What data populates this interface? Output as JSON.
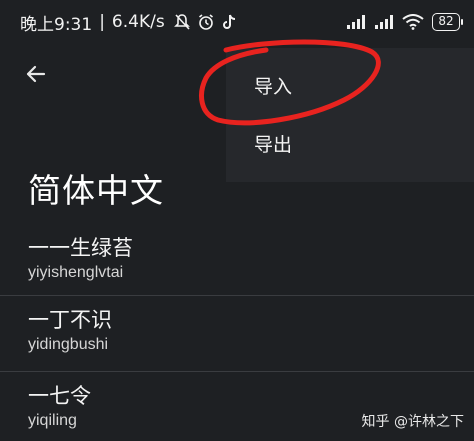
{
  "status_bar": {
    "time": "晚上9:31",
    "separator": "|",
    "speed": "6.4K/s",
    "battery": "82",
    "icons": [
      "mute-icon",
      "alarm-icon",
      "tiktok-icon",
      "signal-icon",
      "signal-icon",
      "wifi-icon",
      "battery-icon"
    ]
  },
  "menu": {
    "import_label": "导入",
    "export_label": "导出"
  },
  "section_title": "简体中文",
  "items": [
    {
      "term": "一一生绿苔",
      "pinyin": "yiyishenglvtai"
    },
    {
      "term": "一丁不识",
      "pinyin": "yidingbushi"
    },
    {
      "term": "一七令",
      "pinyin": "yiqiling"
    }
  ],
  "watermark": "知乎 @许林之下",
  "colors": {
    "background": "#1e2023",
    "menu_background": "#26282c",
    "annotation_red": "#e8231f"
  }
}
